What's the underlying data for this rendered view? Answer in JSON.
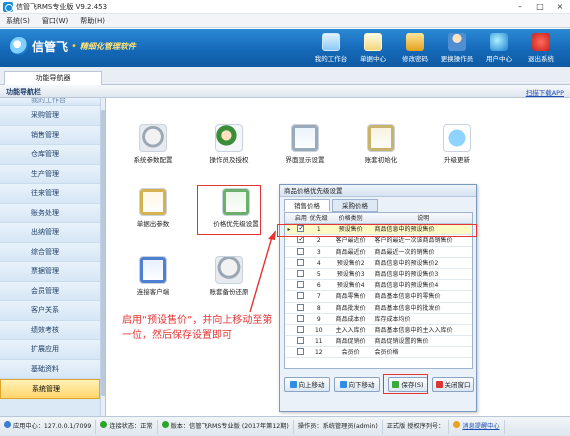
{
  "window": {
    "title": "信管飞RMS专业版 V9.2.453",
    "controls": [
      "–",
      "□",
      "×"
    ]
  },
  "menu": [
    "系统(S)",
    "窗口(W)",
    "帮助(H)"
  ],
  "banner": {
    "brand": "信管飞",
    "slogan": "精细化管理软件",
    "toolbar": [
      {
        "label": "我的工作台",
        "icon": "workstation-icon"
      },
      {
        "label": "单据中心",
        "icon": "document-center-icon"
      },
      {
        "label": "修改密码",
        "icon": "lock-icon"
      },
      {
        "label": "更换操作员",
        "icon": "switch-user-icon"
      },
      {
        "label": "用户中心",
        "icon": "globe-icon"
      },
      {
        "label": "退出系统",
        "icon": "power-icon"
      }
    ]
  },
  "tabs": [
    {
      "label": "功能导航器"
    }
  ],
  "navbar": {
    "title": "功能导航栏",
    "scan_link": "扫描下载APP"
  },
  "sidebar": {
    "items": [
      {
        "label": "我的工作台",
        "partial": true
      },
      {
        "label": "采购管理"
      },
      {
        "label": "销售管理"
      },
      {
        "label": "仓库管理"
      },
      {
        "label": "生产管理"
      },
      {
        "label": "往来管理"
      },
      {
        "label": "账务处理"
      },
      {
        "label": "出纳管理"
      },
      {
        "label": "综合管理"
      },
      {
        "label": "票据管理"
      },
      {
        "label": "会员管理"
      },
      {
        "label": "客户关系"
      },
      {
        "label": "绩效考核"
      },
      {
        "label": "扩展应用"
      },
      {
        "label": "基础资料"
      },
      {
        "label": "系统管理",
        "active": true
      }
    ]
  },
  "modules": [
    {
      "label": "系统参数配置",
      "icon": "database-settings-icon"
    },
    {
      "label": "操作员及授权",
      "icon": "operator-auth-icon"
    },
    {
      "label": "界面显示设置",
      "icon": "display-settings-icon"
    },
    {
      "label": "账套初始化",
      "icon": "account-init-icon"
    },
    {
      "label": "升级更新",
      "icon": "upgrade-icon"
    },
    {
      "label": "单据出参数",
      "icon": "document-params-icon"
    },
    {
      "label": "价格优先级设置",
      "icon": "price-priority-icon"
    },
    {
      "label": "连接客户端",
      "icon": "client-connect-icon"
    },
    {
      "label": "账套备份还原",
      "icon": "backup-restore-icon"
    }
  ],
  "dialog": {
    "title": "商品价格优先级设置",
    "tabs": [
      "销售价格",
      "采购价格"
    ],
    "columns": [
      "启用",
      "优先级",
      "价格类别",
      "说明"
    ],
    "rows": [
      {
        "enabled": true,
        "priority": "1",
        "category": "预设售价",
        "desc": "商品信息中的预设售价",
        "current": true
      },
      {
        "enabled": true,
        "priority": "2",
        "category": "客户最近价",
        "desc": "客户的最近一次该商品销售价"
      },
      {
        "enabled": false,
        "priority": "3",
        "category": "商品最近价",
        "desc": "商品最近一次的销售价"
      },
      {
        "enabled": false,
        "priority": "4",
        "category": "预设售价2",
        "desc": "商品信息中的预设售价2"
      },
      {
        "enabled": false,
        "priority": "5",
        "category": "预设售价3",
        "desc": "商品信息中的预设售价3"
      },
      {
        "enabled": false,
        "priority": "6",
        "category": "预设售价4",
        "desc": "商品信息中的预设售价4"
      },
      {
        "enabled": false,
        "priority": "7",
        "category": "商品零售价",
        "desc": "商品基本信息中的零售价"
      },
      {
        "enabled": false,
        "priority": "8",
        "category": "商品批发价",
        "desc": "商品基本信息中的批发价"
      },
      {
        "enabled": false,
        "priority": "9",
        "category": "商品成本价",
        "desc": "库存成本均价"
      },
      {
        "enabled": false,
        "priority": "10",
        "category": "主入入库价",
        "desc": "商品基本信息中的主入入库价"
      },
      {
        "enabled": false,
        "priority": "11",
        "category": "商品促销价",
        "desc": "商品促销设置的售价"
      },
      {
        "enabled": false,
        "priority": "12",
        "category": "会员价",
        "desc": "会员价格"
      }
    ],
    "buttons": {
      "up": "向上移动",
      "down": "向下移动",
      "save": "保存(S)",
      "close": "关闭窗口"
    }
  },
  "annotation": "启用“预设售价”，并向上移动至第一位，然后保存设置即可",
  "status": {
    "center": "应用中心：127.0.0.1/7099",
    "conn": "连接状态：正常",
    "version": "版本：信管飞RMS专业版 (2017年第12期)",
    "operator": "操作员：系统管理员(admin)",
    "edition": "正式版  授权序列号：",
    "msg": "消息提醒中心"
  },
  "colors": {
    "accent": "#1569b8",
    "highlight": "#e53434",
    "status_ok": "#2aa52a"
  }
}
